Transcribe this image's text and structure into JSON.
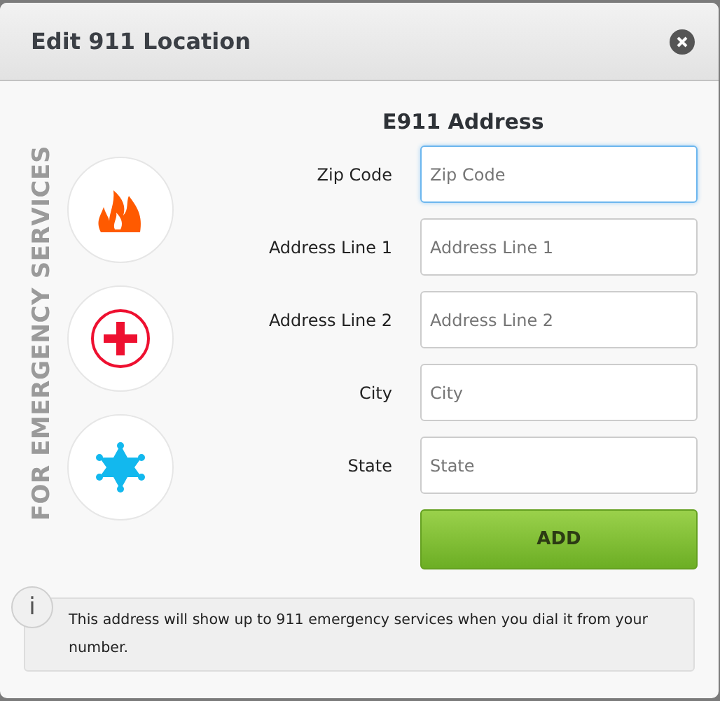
{
  "dialog": {
    "title": "Edit 911 Location"
  },
  "side_caption": "FOR EMERGENCY SERVICES",
  "form": {
    "heading": "E911 Address",
    "fields": [
      {
        "label": "Zip Code",
        "placeholder": "Zip Code",
        "focused": true
      },
      {
        "label": "Address Line 1",
        "placeholder": "Address Line 1",
        "focused": false
      },
      {
        "label": "Address Line 2",
        "placeholder": "Address Line 2",
        "focused": false
      },
      {
        "label": "City",
        "placeholder": "City",
        "focused": false
      },
      {
        "label": "State",
        "placeholder": "State",
        "focused": false
      }
    ],
    "submit": "ADD"
  },
  "info": {
    "badge": "i",
    "text": "This address will show up to 911 emergency services when you dial it from your number."
  }
}
